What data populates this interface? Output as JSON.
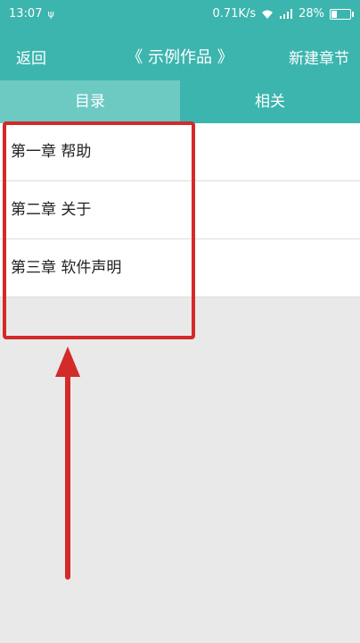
{
  "status_bar": {
    "time": "13:07",
    "speed": "0.71K/s",
    "battery": "28%",
    "battery_level": 0.28
  },
  "header": {
    "back_label": "返回",
    "title": "《 示例作品 》",
    "new_chapter_label": "新建章节"
  },
  "tabs": [
    {
      "label": "目录",
      "active": true
    },
    {
      "label": "相关",
      "active": false
    }
  ],
  "chapters": [
    {
      "label": "第一章 帮助"
    },
    {
      "label": "第二章 关于"
    },
    {
      "label": "第三章 软件声明"
    }
  ],
  "colors": {
    "primary": "#3cb5ae",
    "tab_active": "#6ccac3",
    "annotation": "#d32a2a",
    "background": "#e9e9e9"
  }
}
